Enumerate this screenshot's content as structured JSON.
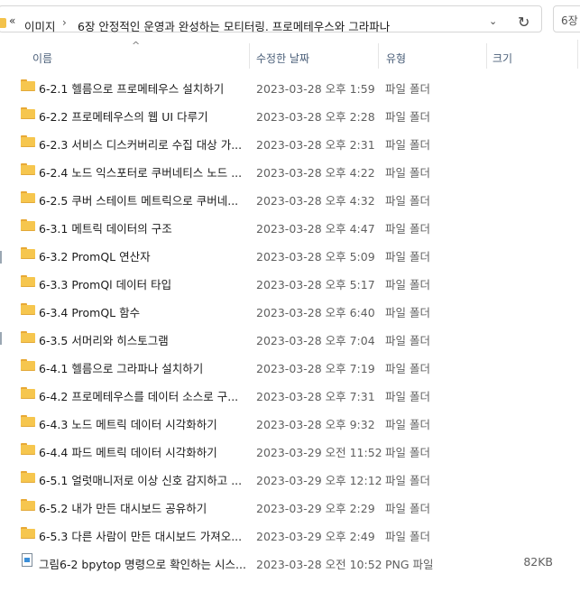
{
  "address_bar": {
    "overflow_label": "«",
    "crumbs": [
      "이미지",
      "6장 안정적인 운영과 완성하는 모티터링. 프로메테우스와 그라파나"
    ],
    "separator": "›",
    "dropdown_icon": "⌄",
    "refresh_icon": "↻",
    "search_text": "6장"
  },
  "header": {
    "sort_arrow": "^",
    "columns": {
      "name": "이름",
      "date": "수정한 날짜",
      "type": "유형",
      "size": "크기"
    }
  },
  "files": [
    {
      "icon": "folder-icon",
      "name": "6-2.1 헬름으로 프로메테우스 설치하기",
      "date": "2023-03-28 오후 1:59",
      "type": "파일 폴더",
      "size": ""
    },
    {
      "icon": "folder-icon",
      "name": "6-2.2 프로메테우스의 웹 UI 다루기",
      "date": "2023-03-28 오후 2:28",
      "type": "파일 폴더",
      "size": ""
    },
    {
      "icon": "folder-icon",
      "name": "6-2.3 서비스 디스커버리로 수집 대상 가...",
      "date": "2023-03-28 오후 2:31",
      "type": "파일 폴더",
      "size": ""
    },
    {
      "icon": "folder-icon",
      "name": "6-2.4 노드 익스포터로 쿠버네티스 노드 ...",
      "date": "2023-03-28 오후 4:22",
      "type": "파일 폴더",
      "size": ""
    },
    {
      "icon": "folder-icon",
      "name": "6-2.5 쿠버 스테이트 메트릭으로 쿠버네...",
      "date": "2023-03-28 오후 4:32",
      "type": "파일 폴더",
      "size": ""
    },
    {
      "icon": "folder-icon",
      "name": "6-3.1 메트릭 데이터의 구조",
      "date": "2023-03-28 오후 4:47",
      "type": "파일 폴더",
      "size": ""
    },
    {
      "icon": "folder-icon",
      "name": "6-3.2 PromQL 연산자",
      "date": "2023-03-28 오후 5:09",
      "type": "파일 폴더",
      "size": ""
    },
    {
      "icon": "folder-icon",
      "name": "6-3.3 PromQl 데이터 타입",
      "date": "2023-03-28 오후 5:17",
      "type": "파일 폴더",
      "size": ""
    },
    {
      "icon": "folder-icon",
      "name": "6-3.4 PromQL 함수",
      "date": "2023-03-28 오후 6:40",
      "type": "파일 폴더",
      "size": ""
    },
    {
      "icon": "folder-icon",
      "name": "6-3.5 서머리와 히스토그램",
      "date": "2023-03-28 오후 7:04",
      "type": "파일 폴더",
      "size": ""
    },
    {
      "icon": "folder-icon",
      "name": "6-4.1 헬름으로 그라파나 설치하기",
      "date": "2023-03-28 오후 7:19",
      "type": "파일 폴더",
      "size": ""
    },
    {
      "icon": "folder-icon",
      "name": "6-4.2 프로메테우스를 데이터 소스로 구...",
      "date": "2023-03-28 오후 7:31",
      "type": "파일 폴더",
      "size": ""
    },
    {
      "icon": "folder-icon",
      "name": "6-4.3 노드 메트릭 데이터 시각화하기",
      "date": "2023-03-28 오후 9:32",
      "type": "파일 폴더",
      "size": ""
    },
    {
      "icon": "folder-icon",
      "name": "6-4.4 파드 메트릭 데이터 시각화하기",
      "date": "2023-03-29 오전 11:52",
      "type": "파일 폴더",
      "size": ""
    },
    {
      "icon": "folder-icon",
      "name": "6-5.1 얼럿매니저로 이상 신호 감지하고 ...",
      "date": "2023-03-29 오후 12:12",
      "type": "파일 폴더",
      "size": ""
    },
    {
      "icon": "folder-icon",
      "name": "6-5.2 내가 만든 대시보드 공유하기",
      "date": "2023-03-29 오후 2:29",
      "type": "파일 폴더",
      "size": ""
    },
    {
      "icon": "folder-icon",
      "name": "6-5.3 다른 사람이 만든 대시보드 가져오...",
      "date": "2023-03-29 오후 2:49",
      "type": "파일 폴더",
      "size": ""
    },
    {
      "icon": "png-file-icon",
      "name": "그림6-2 bpytop 명령으로 확인하는 시스...",
      "date": "2023-03-28 오전 10:52",
      "type": "PNG 파일",
      "size": "82KB"
    }
  ]
}
